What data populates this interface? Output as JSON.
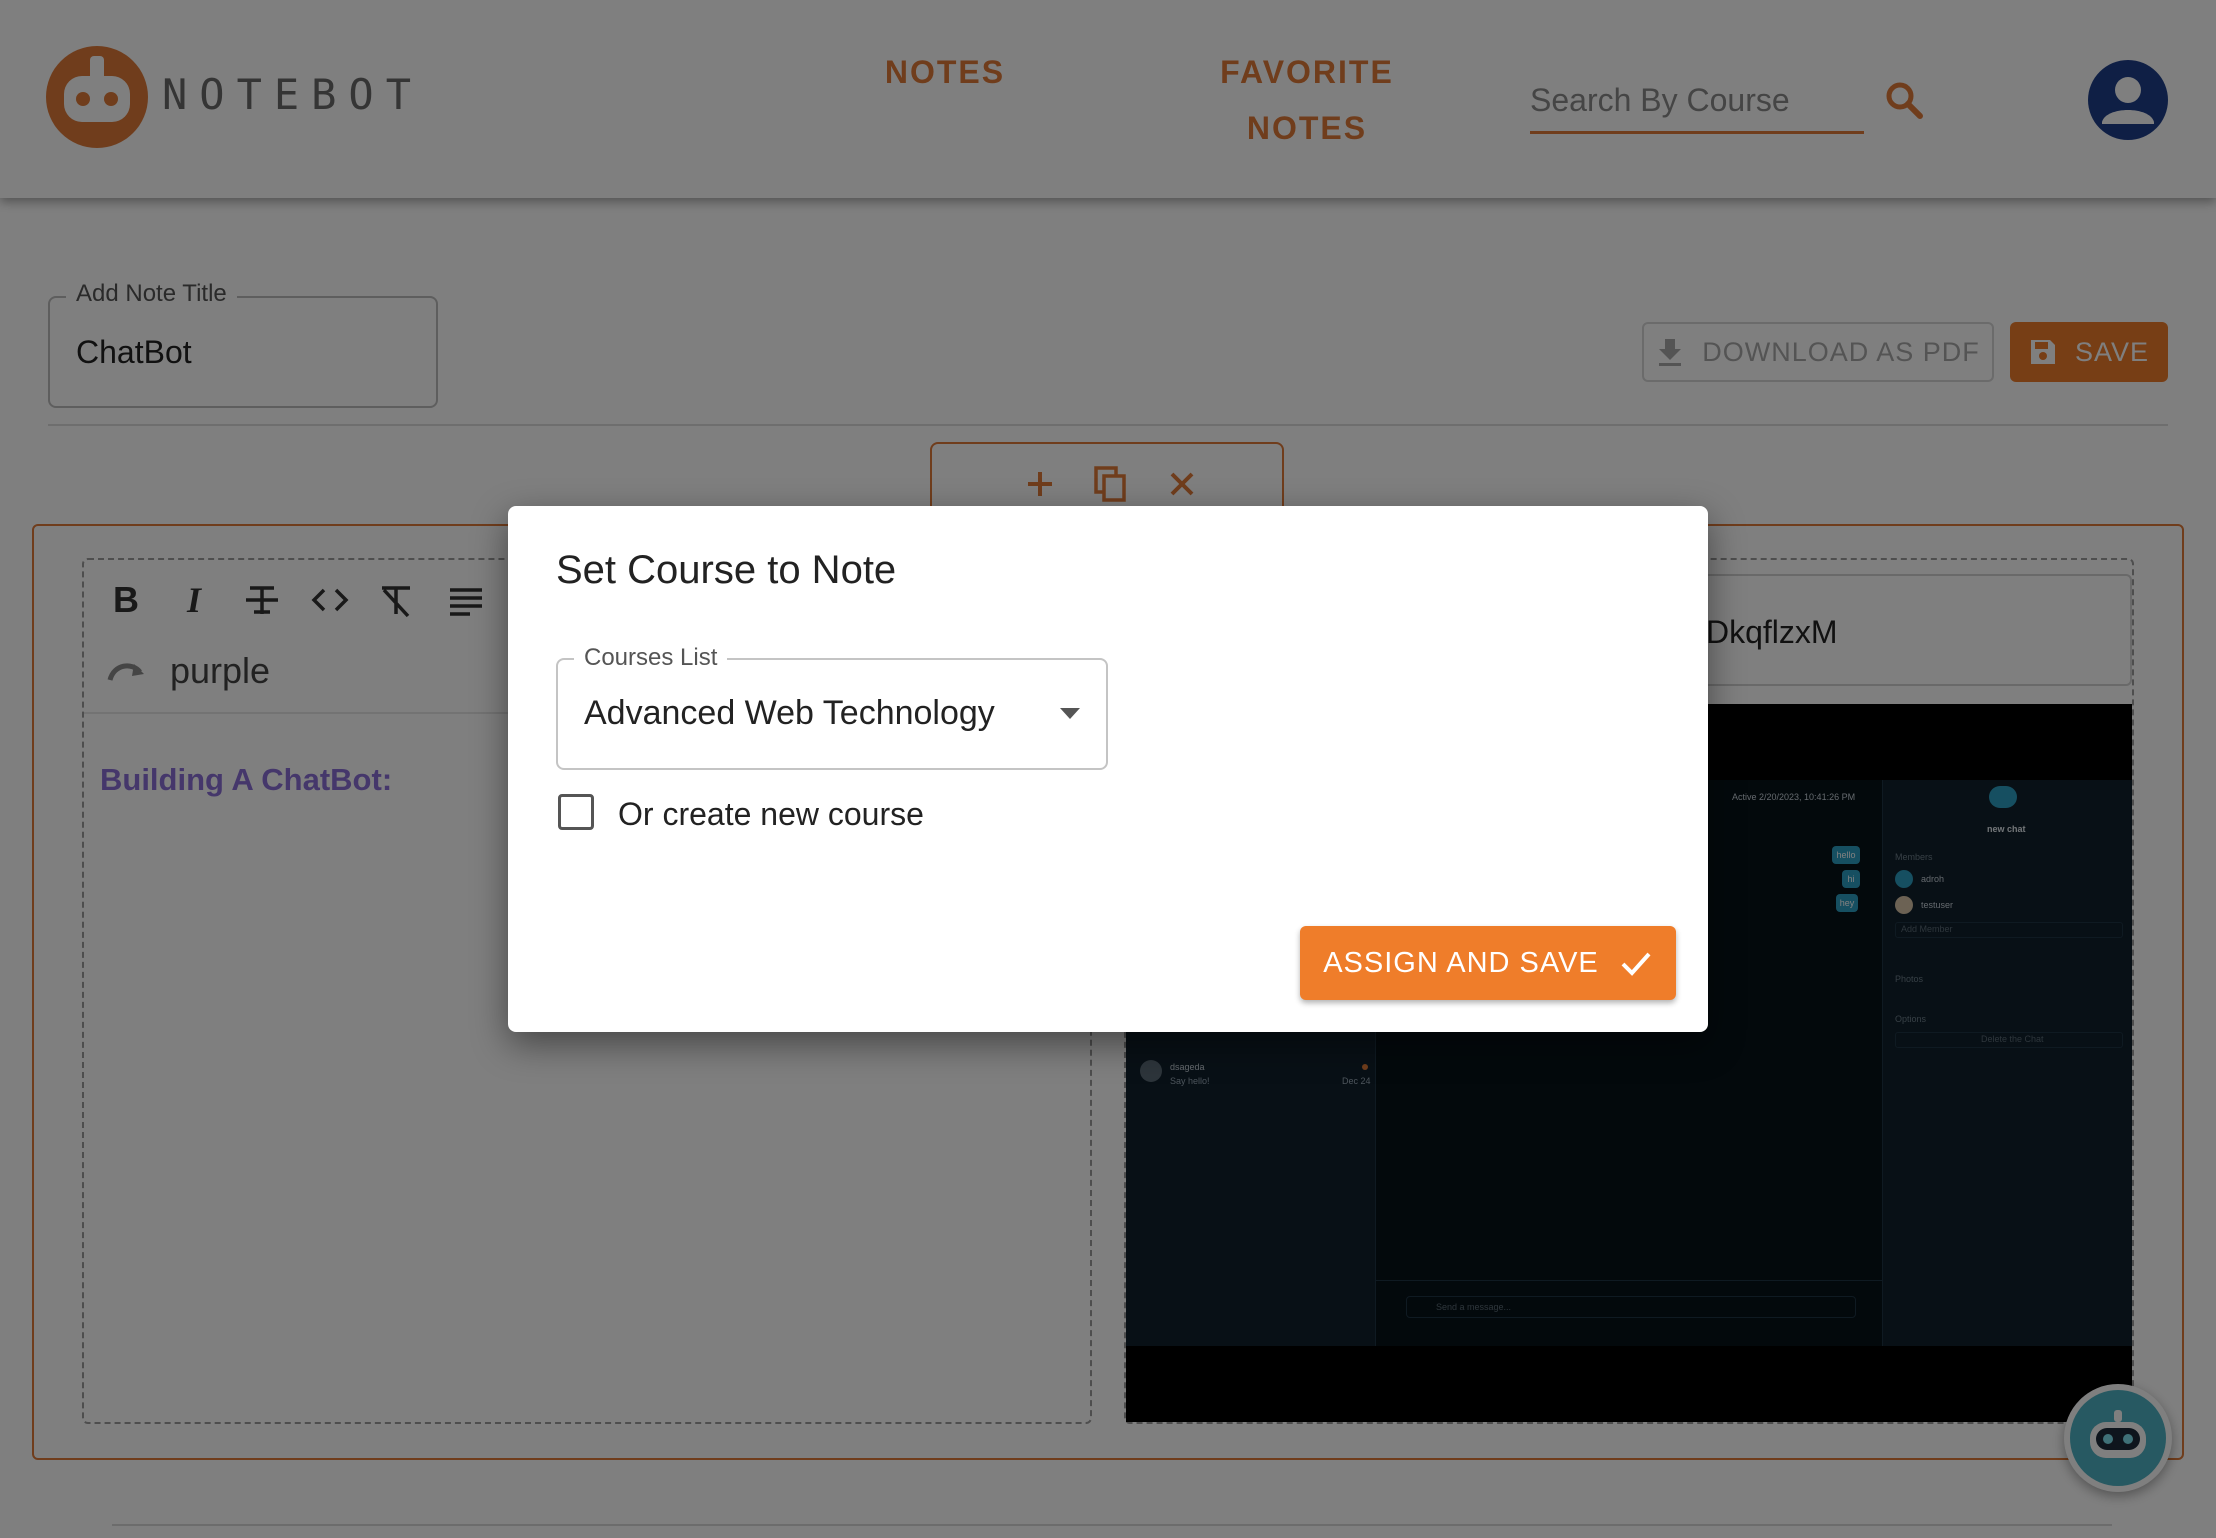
{
  "app": {
    "brand": "NOTEBOT"
  },
  "nav": {
    "notes": "NOTES",
    "favorite_line1": "FAVORITE",
    "favorite_line2": "NOTES"
  },
  "search": {
    "placeholder": "Search By Course",
    "value": ""
  },
  "note": {
    "title_label": "Add Note Title",
    "title_value": "ChatBot",
    "download_label": "DOWNLOAD AS PDF",
    "save_label": "SAVE"
  },
  "editor": {
    "color_label": "purple",
    "heading": "Building A ChatBot:"
  },
  "embed": {
    "url_fragment": "DkqflzxM",
    "shot": {
      "status": "Active 2/20/2023, 10:41:26 PM",
      "panel_title": "new chat",
      "members_label": "Members",
      "member_1": "adroh",
      "member_2": "testuser",
      "add_member": "Add Member",
      "photos_label": "Photos",
      "options_label": "Options",
      "delete_label": "Delete the Chat",
      "chat_name": "dsageda",
      "chat_preview": "Say hello!",
      "chat_date": "Dec 24",
      "message_placeholder": "Send a message...",
      "bubble_1": "hello",
      "bubble_2": "hi",
      "bubble_3": "hey"
    }
  },
  "modal": {
    "title": "Set Course to Note",
    "select_label": "Courses List",
    "selected_course": "Advanced Web Technology",
    "checkbox_label": "Or create new course",
    "checkbox_checked": false,
    "assign_label": "ASSIGN AND SAVE"
  },
  "colors": {
    "accent": "#e07b39",
    "button": "#ef7d2a",
    "avatar": "#1f3f8a",
    "editor_heading": "#8b6fd6"
  }
}
